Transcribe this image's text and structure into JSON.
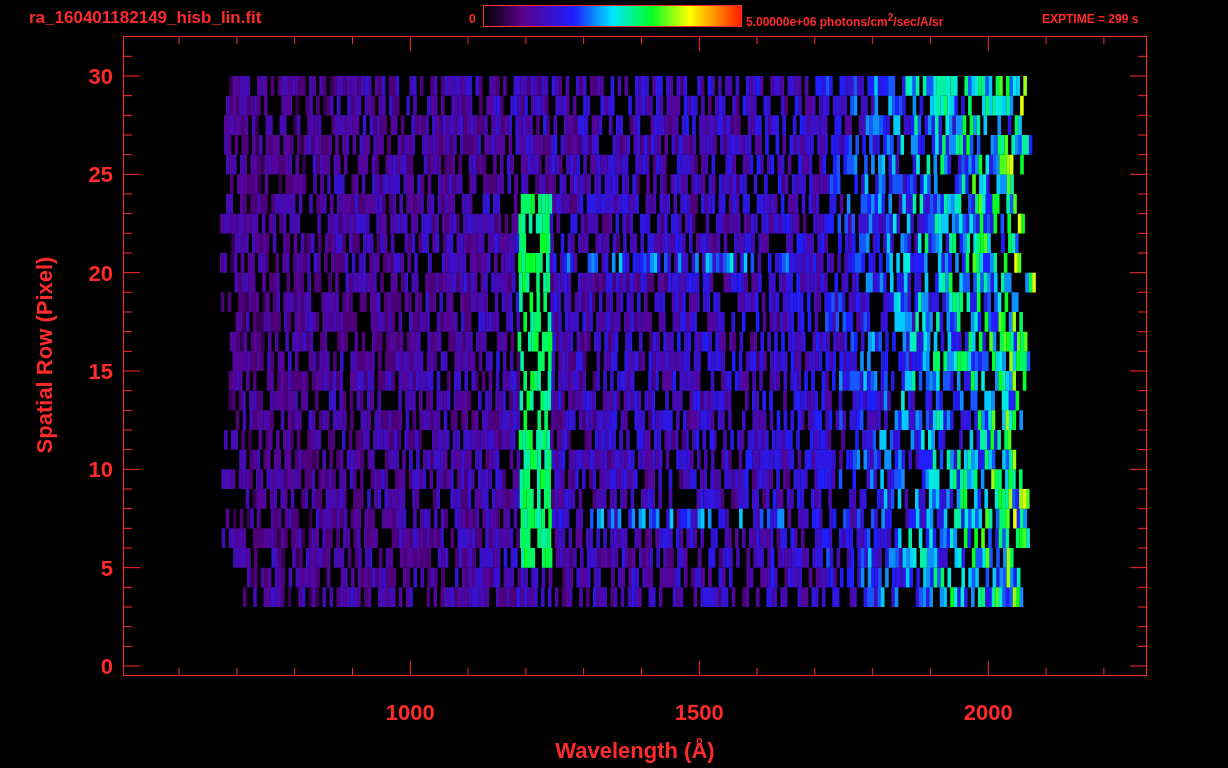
{
  "title": "ra_160401182149_hisb_lin.fit",
  "colorbar": {
    "min_label": "0",
    "max_label": "5.00000e+06 photons/cm$^{2}$/sec/A/sr"
  },
  "exposure": "EXPTIME = 299 s",
  "plot": {
    "xlabel": "Wavelength (Å)",
    "ylabel": "Spatial Row (Pixel)",
    "xticks": [
      "1000",
      "1500",
      "2000"
    ],
    "yticks": [
      "30",
      "25",
      "20",
      "15",
      "10",
      "5",
      "0"
    ]
  }
}
